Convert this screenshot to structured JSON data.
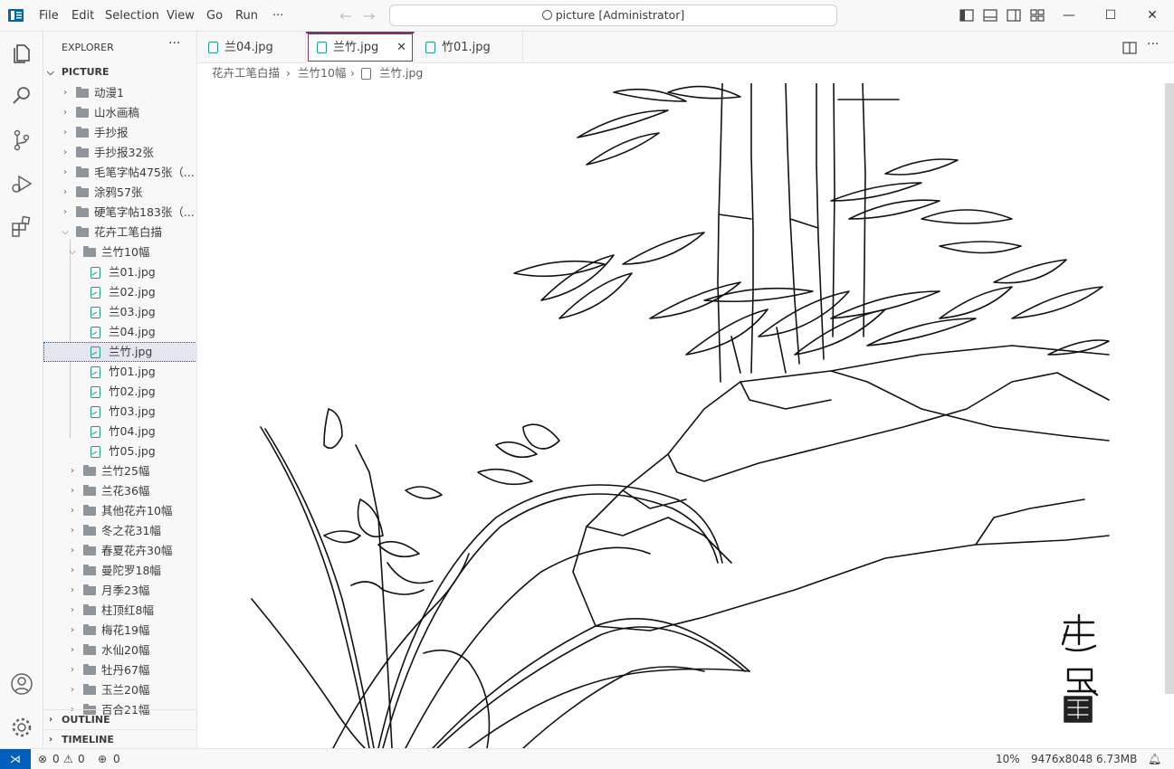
{
  "menu": [
    "File",
    "Edit",
    "Selection",
    "View",
    "Go",
    "Run",
    "···"
  ],
  "search": {
    "text": "picture [Administrator]"
  },
  "window": {
    "minimize": "—",
    "maximize": "☐",
    "close": "✕"
  },
  "explorer": {
    "title": "EXPLORER",
    "more": "···",
    "root": "PICTURE"
  },
  "tree": [
    {
      "label": "动漫1",
      "type": "folder",
      "depth": 0,
      "expanded": false
    },
    {
      "label": "山水画稿",
      "type": "folder",
      "depth": 0,
      "expanded": false
    },
    {
      "label": "手抄报",
      "type": "folder",
      "depth": 0,
      "expanded": false
    },
    {
      "label": "手抄报32张",
      "type": "folder",
      "depth": 0,
      "expanded": false
    },
    {
      "label": "毛笔字帖475张（...",
      "type": "folder",
      "depth": 0,
      "expanded": false
    },
    {
      "label": "涂鸦57张",
      "type": "folder",
      "depth": 0,
      "expanded": false
    },
    {
      "label": "硬笔字帖183张（...",
      "type": "folder",
      "depth": 0,
      "expanded": false
    },
    {
      "label": "花卉工笔白描",
      "type": "folder",
      "depth": 0,
      "expanded": true
    },
    {
      "label": "兰竹10幅",
      "type": "folder",
      "depth": 1,
      "expanded": true
    },
    {
      "label": "兰01.jpg",
      "type": "file",
      "depth": 2
    },
    {
      "label": "兰02.jpg",
      "type": "file",
      "depth": 2
    },
    {
      "label": "兰03.jpg",
      "type": "file",
      "depth": 2
    },
    {
      "label": "兰04.jpg",
      "type": "file",
      "depth": 2
    },
    {
      "label": "兰竹.jpg",
      "type": "file",
      "depth": 2,
      "selected": true
    },
    {
      "label": "竹01.jpg",
      "type": "file",
      "depth": 2
    },
    {
      "label": "竹02.jpg",
      "type": "file",
      "depth": 2
    },
    {
      "label": "竹03.jpg",
      "type": "file",
      "depth": 2
    },
    {
      "label": "竹04.jpg",
      "type": "file",
      "depth": 2
    },
    {
      "label": "竹05.jpg",
      "type": "file",
      "depth": 2
    },
    {
      "label": "兰竹25幅",
      "type": "folder",
      "depth": 1,
      "expanded": false
    },
    {
      "label": "兰花36幅",
      "type": "folder",
      "depth": 1,
      "expanded": false
    },
    {
      "label": "其他花卉10幅",
      "type": "folder",
      "depth": 1,
      "expanded": false
    },
    {
      "label": "冬之花31幅",
      "type": "folder",
      "depth": 1,
      "expanded": false
    },
    {
      "label": "春夏花卉30幅",
      "type": "folder",
      "depth": 1,
      "expanded": false
    },
    {
      "label": "曼陀罗18幅",
      "type": "folder",
      "depth": 1,
      "expanded": false
    },
    {
      "label": "月季23幅",
      "type": "folder",
      "depth": 1,
      "expanded": false
    },
    {
      "label": "柱顶红8幅",
      "type": "folder",
      "depth": 1,
      "expanded": false
    },
    {
      "label": "梅花19幅",
      "type": "folder",
      "depth": 1,
      "expanded": false
    },
    {
      "label": "水仙20幅",
      "type": "folder",
      "depth": 1,
      "expanded": false
    },
    {
      "label": "牡丹67幅",
      "type": "folder",
      "depth": 1,
      "expanded": false
    },
    {
      "label": "玉兰20幅",
      "type": "folder",
      "depth": 1,
      "expanded": false
    },
    {
      "label": "百合21幅",
      "type": "folder",
      "depth": 1,
      "expanded": false
    }
  ],
  "panels": {
    "outline": "OUTLINE",
    "timeline": "TIMELINE"
  },
  "tabs": [
    {
      "label": "兰04.jpg"
    },
    {
      "label": "兰竹.jpg",
      "active": true,
      "close": "✕"
    },
    {
      "label": "竹01.jpg"
    }
  ],
  "breadcrumb": [
    "花卉工笔白描",
    "兰竹10幅",
    "兰竹.jpg"
  ],
  "image": {
    "signature": "建民"
  },
  "status": {
    "errors": "0",
    "warnings": "0",
    "ports": "0",
    "zoom": "10%",
    "dimensions": "9476x8048",
    "size": "6.73MB"
  },
  "colors": {
    "accent": "#005fb8",
    "active_tab_border": "#8b2d6f",
    "file_icon": "#1a9e84"
  }
}
